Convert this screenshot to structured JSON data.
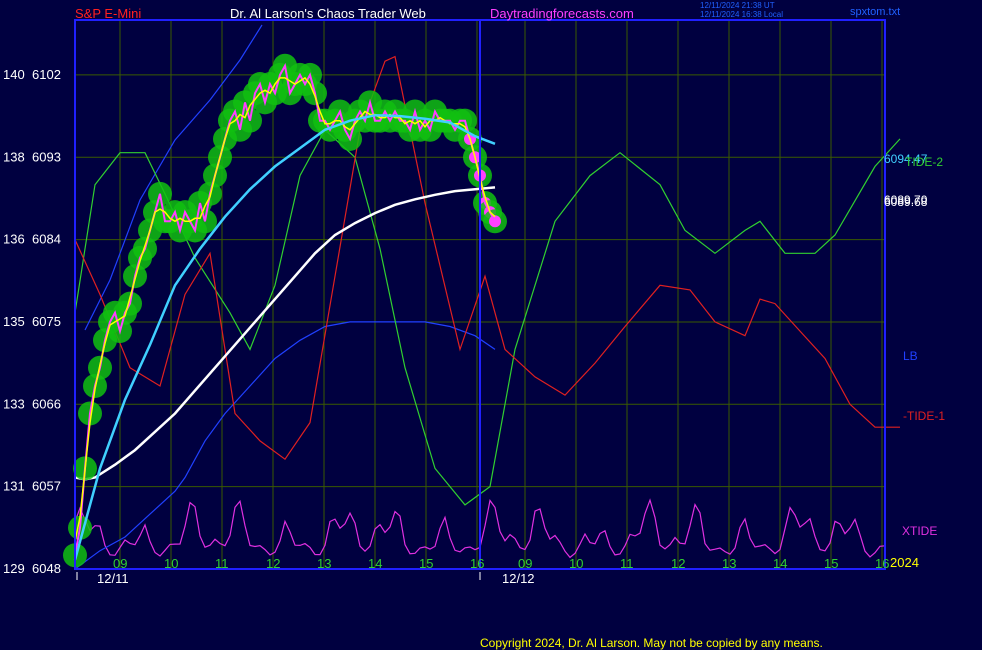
{
  "header": {
    "symbol": "S&P E-Mini",
    "author": "Dr. Al Larson's Chaos Trader Web",
    "site": "Daytradingforecasts.com",
    "timestamp_utc": "12/11/2024 21:38 UT",
    "timestamp_local": "12/11/2024 16:38 Local",
    "file": "spxtom.txt"
  },
  "footer": {
    "copyright": "Copyright 2024, Dr. Al Larson. May not be copied by any means."
  },
  "colors": {
    "background": "#000040",
    "frame": "#2020ff",
    "grid": "#3a5a00",
    "price_halo": "#10c010",
    "price": "#ff40ff",
    "price_smooth": "#ffff00",
    "ma_fast": "#40d0ff",
    "ma_slow": "#ffffff",
    "tide2": "#30d030",
    "tide1": "#e02020",
    "lb": "#2040ff",
    "xtide": "#e030e0",
    "header_red": "#ff2020",
    "header_white": "#ffffff",
    "header_magenta": "#ff40ff",
    "header_blue": "#2060ff"
  },
  "chart_data": {
    "type": "line",
    "title": "S&P E-Mini",
    "ylim": [
      6048,
      6108
    ],
    "y_ticks": [
      {
        "value": 6048,
        "left": "129",
        "right": "6048"
      },
      {
        "value": 6057,
        "left": "131",
        "right": "6057"
      },
      {
        "value": 6066,
        "left": "133",
        "right": "6066"
      },
      {
        "value": 6075,
        "left": "135",
        "right": "6075"
      },
      {
        "value": 6084,
        "left": "136",
        "right": "6084"
      },
      {
        "value": 6093,
        "left": "138",
        "right": "6093"
      },
      {
        "value": 6102,
        "left": "140",
        "right": "6102"
      }
    ],
    "x_ticks": [
      "09",
      "10",
      "11",
      "12",
      "13",
      "14",
      "15",
      "16",
      "09",
      "10",
      "11",
      "12",
      "13",
      "14",
      "15",
      "16"
    ],
    "date_labels": [
      "12/11",
      "12/12"
    ],
    "year_label": "2024",
    "price_labels": [
      "6094.47",
      "6089.70",
      "6089.68"
    ],
    "series": [
      {
        "name": "S&P E-Mini",
        "key": "price",
        "t": [
          0,
          1,
          2,
          3,
          4,
          5,
          6,
          7,
          8,
          9,
          10,
          11,
          12,
          13,
          14,
          15,
          16,
          17,
          18,
          19,
          20,
          21,
          22,
          23,
          24,
          25,
          26,
          27,
          28,
          29,
          30,
          31,
          32,
          33,
          34,
          35,
          36,
          37,
          38,
          39,
          40,
          41,
          42,
          43,
          44,
          45,
          46,
          47,
          48,
          49,
          50,
          51,
          52,
          53,
          54,
          55,
          56,
          57,
          58,
          59,
          60,
          61,
          62,
          63,
          64,
          65,
          66,
          67,
          68,
          69,
          70,
          71,
          72,
          73,
          74,
          75,
          76,
          77,
          78,
          79,
          80,
          81,
          82,
          83,
          84
        ],
        "values": [
          6049.5,
          6052.5,
          6059,
          6065,
          6068,
          6070,
          6073,
          6075,
          6076,
          6074,
          6076,
          6077,
          6080,
          6082,
          6083,
          6085,
          6087,
          6089,
          6086,
          6086,
          6087,
          6085,
          6087,
          6086,
          6085,
          6088,
          6086,
          6089,
          6091,
          6093,
          6095,
          6097,
          6098,
          6096,
          6099,
          6097,
          6100,
          6101,
          6099,
          6101,
          6100,
          6102,
          6103,
          6100,
          6101,
          6102,
          6101,
          6102,
          6100,
          6097,
          6097,
          6096,
          6097,
          6098,
          6096,
          6095,
          6097,
          6098,
          6097,
          6099,
          6097,
          6097,
          6098,
          6097,
          6098,
          6097,
          6097,
          6096,
          6098,
          6096,
          6097,
          6096,
          6098,
          6097,
          6097,
          6097,
          6096,
          6097,
          6097,
          6095,
          6093,
          6091,
          6088,
          6087,
          6086
        ]
      },
      {
        "name": "",
        "key": "ma_fast",
        "t": [
          0,
          5,
          10,
          15,
          20,
          25,
          30,
          35,
          40,
          45,
          50,
          55,
          60,
          65,
          70,
          75,
          80,
          84
        ],
        "values": [
          6049,
          6059,
          6066.5,
          6072.5,
          6079,
          6083,
          6086.5,
          6089.5,
          6092,
          6094,
          6096,
          6097,
          6097.6,
          6097.5,
          6097.2,
          6096.8,
          6095.3,
          6094.47
        ]
      },
      {
        "name": "",
        "key": "ma_slow",
        "t": [
          0,
          2,
          4,
          8,
          12,
          16,
          20,
          24,
          28,
          32,
          36,
          40,
          44,
          48,
          52,
          56,
          60,
          64,
          68,
          72,
          76,
          80,
          84
        ],
        "values": [
          6058,
          6057.8,
          6058,
          6059.4,
          6061,
          6063,
          6065,
          6067.5,
          6070,
          6072.5,
          6075,
          6077.5,
          6080,
          6082.5,
          6084.5,
          6085.8,
          6086.9,
          6087.8,
          6088.4,
          6088.9,
          6089.3,
          6089.5,
          6089.7
        ]
      },
      {
        "name": "TIDE-2",
        "t": [
          0,
          4,
          9,
          14,
          18,
          24,
          31,
          35,
          40,
          45,
          50,
          56,
          61,
          66,
          72,
          78,
          83,
          88,
          96,
          103,
          109,
          117,
          122,
          128,
          134,
          137,
          142,
          148,
          152,
          160,
          165
        ],
        "values": [
          6076,
          6090,
          6093.5,
          6093.5,
          6089,
          6082,
          6076,
          6072,
          6079,
          6091,
          6096,
          6093,
          6083,
          6070,
          6059,
          6055,
          6057,
          6072,
          6086,
          6091,
          6093.5,
          6090,
          6085,
          6082.5,
          6085,
          6086,
          6082.5,
          6082.5,
          6084.5,
          6092,
          6095
        ]
      },
      {
        "name": "-TIDE-1",
        "t": [
          0,
          5,
          11,
          17,
          22,
          27,
          32,
          37,
          42,
          47,
          52,
          57,
          62,
          64,
          70,
          77,
          82,
          86,
          92,
          98,
          104,
          110,
          117,
          123,
          128,
          134,
          137,
          140,
          145,
          150,
          155,
          160,
          165
        ],
        "values": [
          6084,
          6078,
          6070,
          6068,
          6078,
          6082.5,
          6065,
          6062,
          6060,
          6064,
          6080,
          6096,
          6103.5,
          6104,
          6088,
          6072,
          6080,
          6072,
          6069,
          6067,
          6070.5,
          6074.5,
          6079,
          6078.5,
          6075,
          6073.5,
          6077.5,
          6077,
          6074,
          6071,
          6066,
          6063.5,
          6063.5
        ]
      },
      {
        "name": "LB",
        "t": [
          0,
          5,
          10,
          15,
          20,
          22,
          26,
          30,
          35,
          40,
          45,
          50,
          55,
          60,
          65,
          70,
          75,
          80,
          84
        ],
        "values": [
          6048,
          6050,
          6051.5,
          6054,
          6056.5,
          6058,
          6062,
          6065,
          6068,
          6071,
          6073,
          6074.5,
          6075,
          6075,
          6075,
          6075,
          6074.5,
          6073.5,
          6072
        ]
      },
      {
        "name": "XTIDE",
        "key": "xtide",
        "t": [
          0,
          84,
          165
        ],
        "values": [
          6052,
          6052,
          6052
        ]
      }
    ]
  }
}
